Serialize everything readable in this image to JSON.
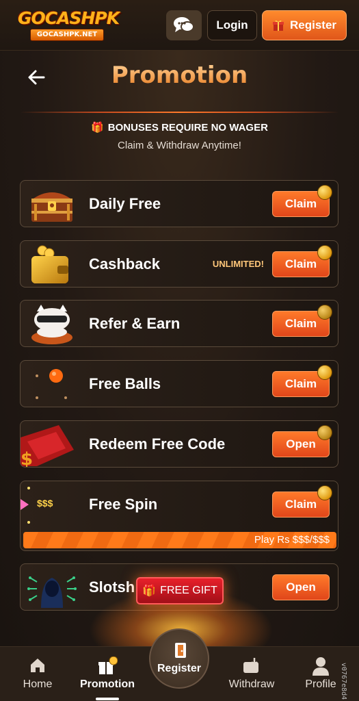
{
  "header": {
    "logo_brand": "GOCASHPK",
    "logo_domain": "GOCASHPK.NET",
    "login_label": "Login",
    "register_label": "Register"
  },
  "page": {
    "title": "Promotion",
    "bonus_line1": "BONUSES REQUIRE NO WAGER",
    "bonus_line2": "Claim & Withdraw Anytime!"
  },
  "promotions": [
    {
      "label": "Daily Free",
      "action": "Claim",
      "icon": "treasure-chest-icon"
    },
    {
      "label": "Cashback",
      "action": "Claim",
      "badge": "UNLIMITED!",
      "icon": "wallet-icon"
    },
    {
      "label": "Refer & Earn",
      "action": "Claim",
      "icon": "lucky-cat-icon"
    },
    {
      "label": "Free Balls",
      "action": "Claim",
      "icon": "ball-icon"
    },
    {
      "label": "Redeem Free Code",
      "action": "Open",
      "icon": "ticket-icon"
    },
    {
      "label": "Free Spin",
      "action": "Claim",
      "marker": "$$$",
      "progress_text": "Play Rs $$$/$$$",
      "progress_fraction": 1.0,
      "icon": "spin-icon"
    },
    {
      "label": "Slotsh",
      "action": "Open",
      "icon": "hacker-icon"
    }
  ],
  "free_gift_label": "FREE GIFT",
  "bottom_nav": {
    "home": "Home",
    "promotion": "Promotion",
    "register": "Register",
    "withdraw": "Withdraw",
    "profile": "Profile"
  },
  "version": "v0767e8d4",
  "colors": {
    "accent": "#ff7a2a",
    "title_gradient_top": "#ffd49a",
    "title_gradient_bottom": "#e87b1f",
    "gift_red": "#e8202a"
  }
}
